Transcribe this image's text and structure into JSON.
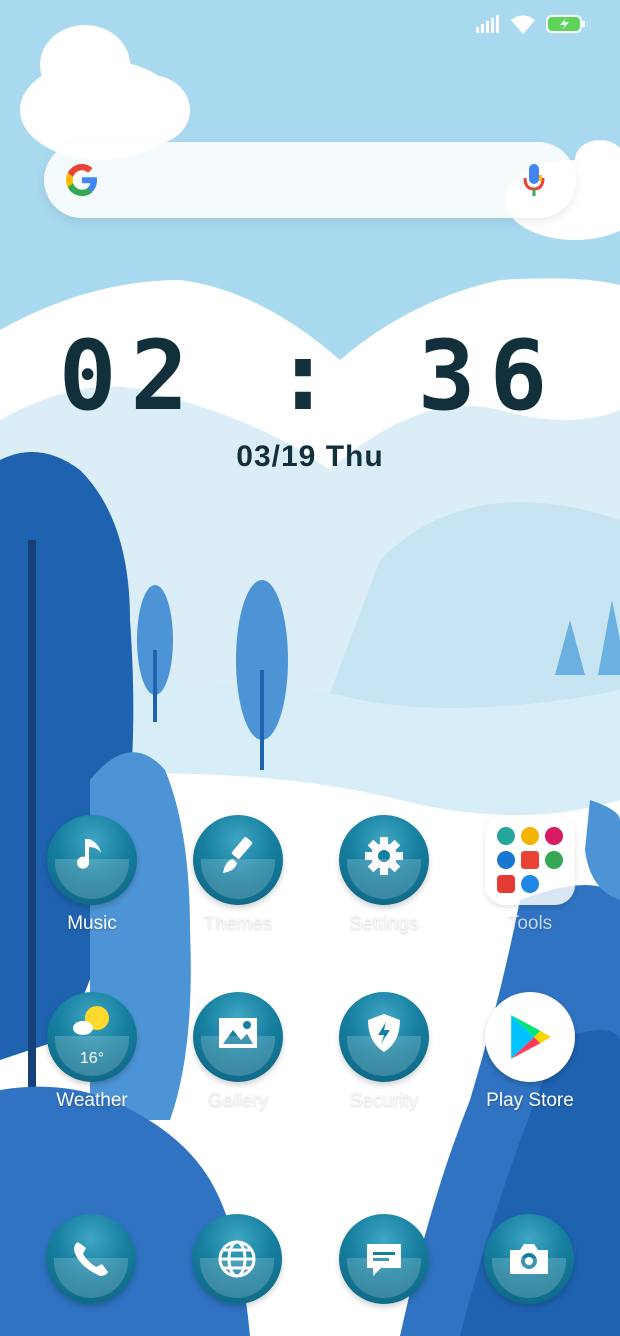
{
  "clock": {
    "time": "02 : 36",
    "date": "03/19 Thu"
  },
  "search": {
    "icons": [
      "google-logo",
      "microphone-icon"
    ]
  },
  "status_bar": {
    "icons": [
      "signal-icon",
      "wifi-icon",
      "battery-charging-icon"
    ]
  },
  "apps": [
    {
      "label": "Music",
      "icon": "music-note-icon"
    },
    {
      "label": "Themes",
      "icon": "paintbrush-icon"
    },
    {
      "label": "Settings",
      "icon": "gear-icon"
    },
    {
      "label": "Tools",
      "icon": "folder-icon"
    },
    {
      "label": "Weather",
      "icon": "weather-icon",
      "temp": "16°"
    },
    {
      "label": "Gallery",
      "icon": "image-icon"
    },
    {
      "label": "Security",
      "icon": "shield-icon"
    },
    {
      "label": "Play Store",
      "icon": "play-store-icon"
    }
  ],
  "dock": [
    {
      "icon": "phone-icon"
    },
    {
      "icon": "globe-icon"
    },
    {
      "icon": "message-icon"
    },
    {
      "icon": "camera-icon"
    }
  ],
  "colors": {
    "sky": "#a9d9ef",
    "icon_teal": "#167f9f",
    "clock": "#12303c",
    "tree_dark": "#1e62b0"
  }
}
